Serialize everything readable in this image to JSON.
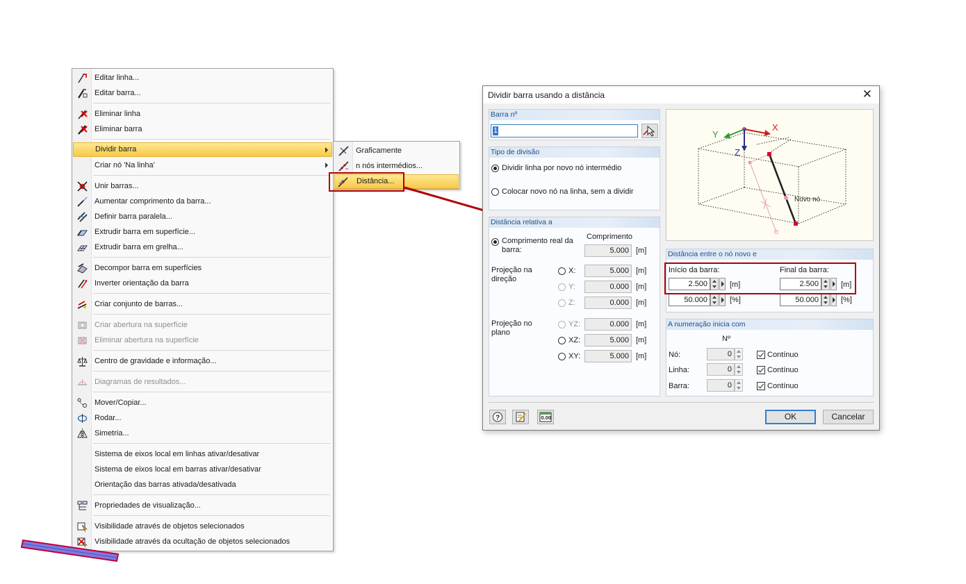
{
  "context_menu": {
    "items": [
      {
        "label": "Editar linha...",
        "icon": "edit-line-icon",
        "disabled": false
      },
      {
        "label": "Editar barra...",
        "icon": "edit-member-icon",
        "disabled": false
      },
      {
        "label": "Eliminar linha",
        "icon": "delete-line-icon",
        "disabled": false
      },
      {
        "label": "Eliminar barra",
        "icon": "delete-member-icon",
        "disabled": false
      },
      {
        "label": "Dividir barra",
        "icon": "",
        "disabled": false,
        "highlighted": true,
        "submenu": true
      },
      {
        "label": "Criar nó 'Na linha'",
        "icon": "",
        "disabled": false,
        "submenu": true
      },
      {
        "label": "Unir barras...",
        "icon": "join-members-icon",
        "disabled": false
      },
      {
        "label": "Aumentar comprimento da barra...",
        "icon": "extend-member-icon",
        "disabled": false
      },
      {
        "label": "Definir barra paralela...",
        "icon": "parallel-member-icon",
        "disabled": false
      },
      {
        "label": "Extrudir barra em superfície...",
        "icon": "extrude-surface-icon",
        "disabled": false
      },
      {
        "label": "Extrudir barra em grelha...",
        "icon": "extrude-grid-icon",
        "disabled": false
      },
      {
        "label": "Decompor barra em superfícies",
        "icon": "decompose-icon",
        "disabled": false
      },
      {
        "label": "Inverter orientação da barra",
        "icon": "reverse-orientation-icon",
        "disabled": false
      },
      {
        "label": "Criar conjunto de barras...",
        "icon": "member-set-icon",
        "disabled": false
      },
      {
        "label": "Criar abertura na superfície",
        "icon": "create-opening-icon",
        "disabled": true
      },
      {
        "label": "Eliminar abertura na superfície",
        "icon": "delete-opening-icon",
        "disabled": true
      },
      {
        "label": "Centro de gravidade e informação...",
        "icon": "center-of-gravity-icon",
        "disabled": false
      },
      {
        "label": "Diagramas de resultados...",
        "icon": "result-diagram-icon",
        "disabled": true
      },
      {
        "label": "Mover/Copiar...",
        "icon": "move-copy-icon",
        "disabled": false
      },
      {
        "label": "Rodar...",
        "icon": "rotate-icon",
        "disabled": false
      },
      {
        "label": "Simetria...",
        "icon": "mirror-icon",
        "disabled": false
      },
      {
        "label": "Sistema de eixos local em linhas ativar/desativar",
        "icon": "",
        "disabled": false
      },
      {
        "label": "Sistema de eixos local em barras ativar/desativar",
        "icon": "",
        "disabled": false
      },
      {
        "label": "Orientação das barras ativada/desativada",
        "icon": "",
        "disabled": false
      },
      {
        "label": "Propriedades de visualização...",
        "icon": "display-properties-icon",
        "disabled": false
      },
      {
        "label": "Visibilidade através de objetos selecionados",
        "icon": "visibility-selected-icon",
        "disabled": false
      },
      {
        "label": "Visibilidade através da ocultação de objetos selecionados",
        "icon": "visibility-hide-icon",
        "disabled": false
      }
    ]
  },
  "submenu": {
    "items": [
      {
        "label": "Graficamente",
        "icon": "graphic-divide-icon"
      },
      {
        "label": "n nós intermédios...",
        "icon": "n-nodes-icon"
      },
      {
        "label": "Distância...",
        "icon": "distance-icon",
        "highlighted": true
      }
    ]
  },
  "dialog": {
    "title": "Dividir barra usando a distância",
    "member_no": {
      "header": "Barra nº",
      "value": "1"
    },
    "division_type": {
      "header": "Tipo de divisão",
      "option1": "Dividir linha por novo nó intermédio",
      "option2": "Colocar novo nó na linha, sem a dividir"
    },
    "relative": {
      "header": "Distância relativa a",
      "col_header": "Comprimento",
      "real_length_label": "Comprimento real da barra:",
      "real_length_value": "5.000",
      "proj_dir_label": "Projeção na direção",
      "proj_plane_label": "Projeção no plano",
      "x_label": "X:",
      "x_value": "5.000",
      "y_label": "Y:",
      "y_value": "0.000",
      "z_label": "Z:",
      "z_value": "0.000",
      "yz_label": "YZ:",
      "yz_value": "0.000",
      "xz_label": "XZ:",
      "xz_value": "5.000",
      "xy_label": "XY:",
      "xy_value": "5.000",
      "unit": "[m]"
    },
    "preview": {
      "x_axis": "X",
      "y_axis": "Y",
      "z_axis": "Z",
      "node_label": "Novo nó"
    },
    "distance": {
      "header": "Distância entre o nó novo e",
      "start_label": "Início da barra:",
      "end_label": "Final da barra:",
      "start_m": "2.500",
      "end_m": "2.500",
      "start_pct": "50.000",
      "end_pct": "50.000",
      "unit_m": "[m]",
      "unit_pct": "[%]"
    },
    "numbering": {
      "header": "A numeração inicia com",
      "col_header": "Nº",
      "node_label": "Nó:",
      "node_value": "0",
      "line_label": "Linha:",
      "line_value": "0",
      "member_label": "Barra:",
      "member_value": "0",
      "continuous": "Contínuo"
    },
    "buttons": {
      "ok": "OK",
      "cancel": "Cancelar"
    },
    "footer_icons": [
      "help-icon",
      "edit-icon",
      "decimal-places-icon"
    ]
  },
  "colors": {
    "highlight": "#f8c84a",
    "callout": "#b00000",
    "group_header": "#1f4f86",
    "member_bar": "#7c7ce0"
  }
}
